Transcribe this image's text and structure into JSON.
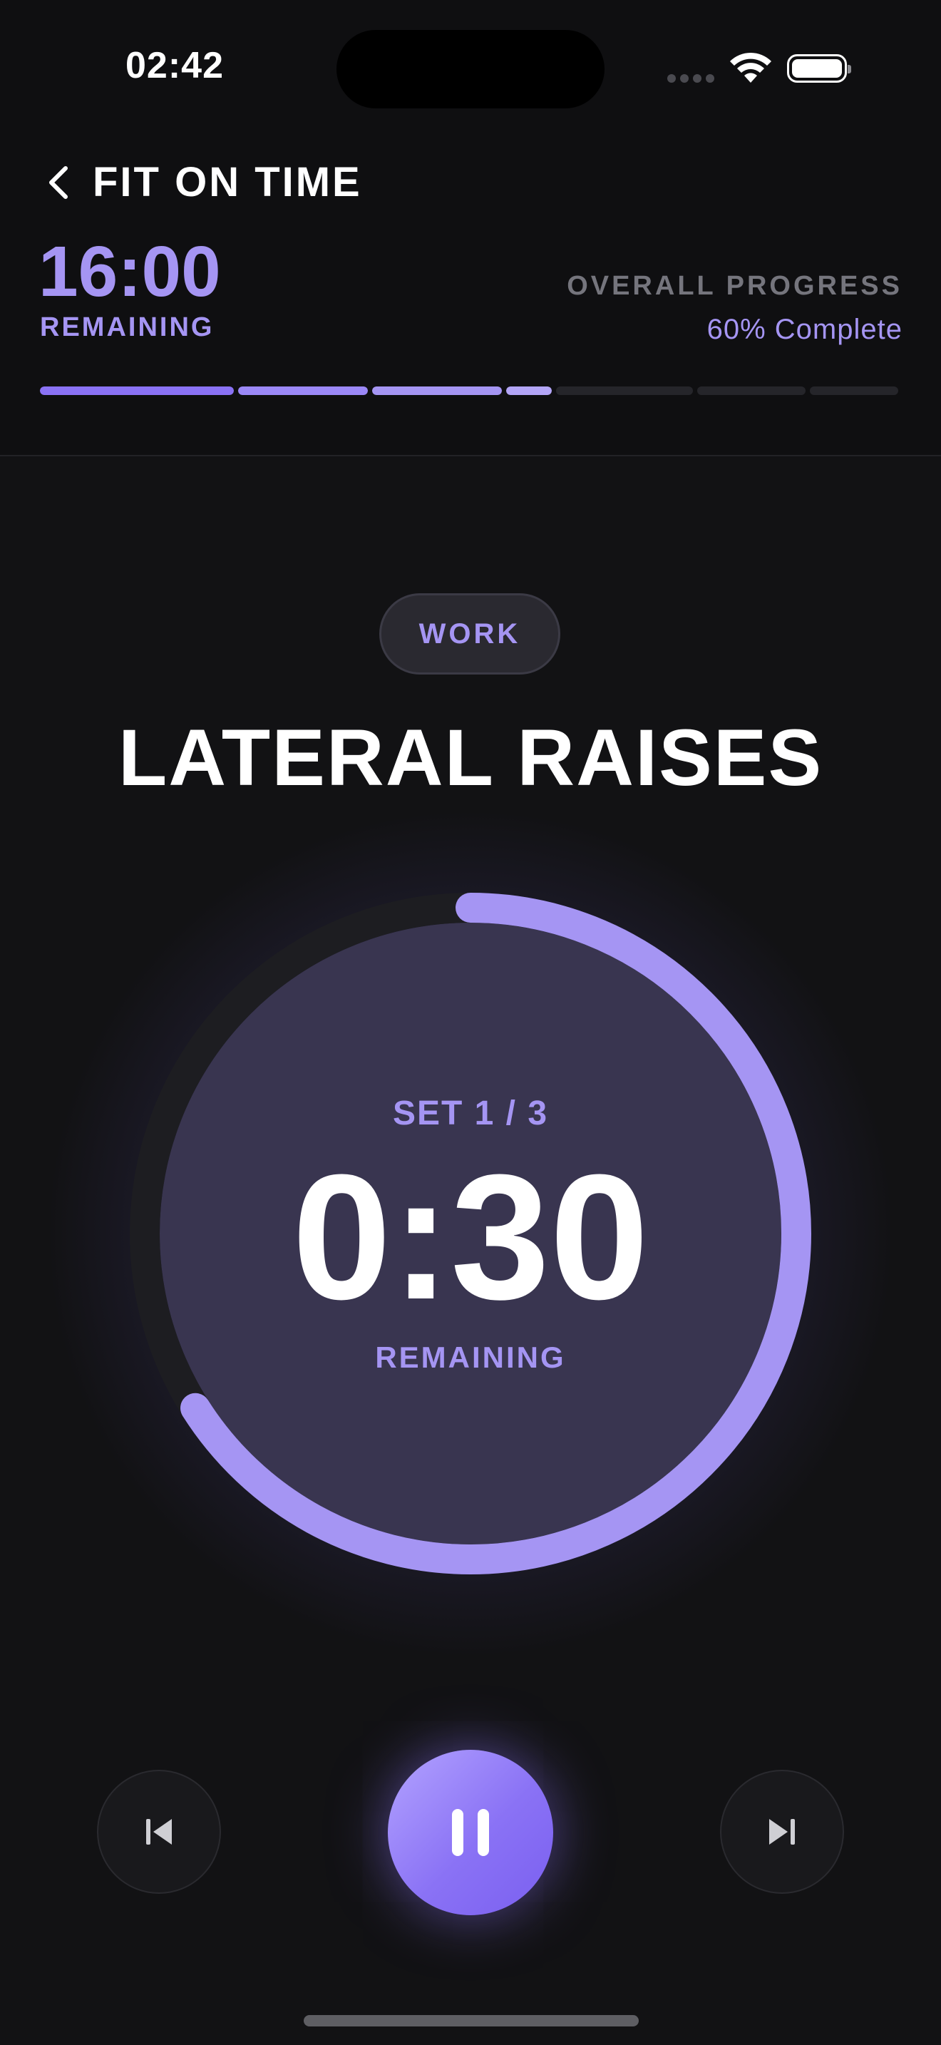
{
  "status_bar": {
    "time": "02:42"
  },
  "header": {
    "back_icon": "chevron-left-icon",
    "app_title": "FIT ON TIME",
    "time_remaining": "16:00",
    "time_remaining_label": "REMAINING",
    "progress_label": "OVERALL PROGRESS",
    "progress_value": "60% Complete",
    "progress_segments": [
      {
        "fill": 1.0,
        "color": "#8a72f5"
      },
      {
        "fill": 1.0,
        "color": "#9b88f7"
      },
      {
        "fill": 1.0,
        "color": "#a595f3"
      },
      {
        "fill": 1.0,
        "color": "#b3a5f7"
      },
      {
        "fill": 0.0,
        "color": "#25252a"
      },
      {
        "fill": 0.0,
        "color": "#25252a"
      },
      {
        "fill": 0.0,
        "color": "#25252a"
      }
    ]
  },
  "workout": {
    "phase": "WORK",
    "exercise_name": "LATERAL RAISES",
    "set_label": "SET 1 / 3",
    "timer": "0:30",
    "timer_label": "REMAINING",
    "ring_progress": 0.66
  },
  "controls": {
    "previous_icon": "skip-previous-icon",
    "pause_icon": "pause-icon",
    "next_icon": "skip-next-icon"
  },
  "colors": {
    "accent": "#a595f3",
    "accent_strong": "#8a72f5",
    "background": "#121214",
    "ring_track": "#1d1d21",
    "ring_inner": "#3a3650"
  }
}
